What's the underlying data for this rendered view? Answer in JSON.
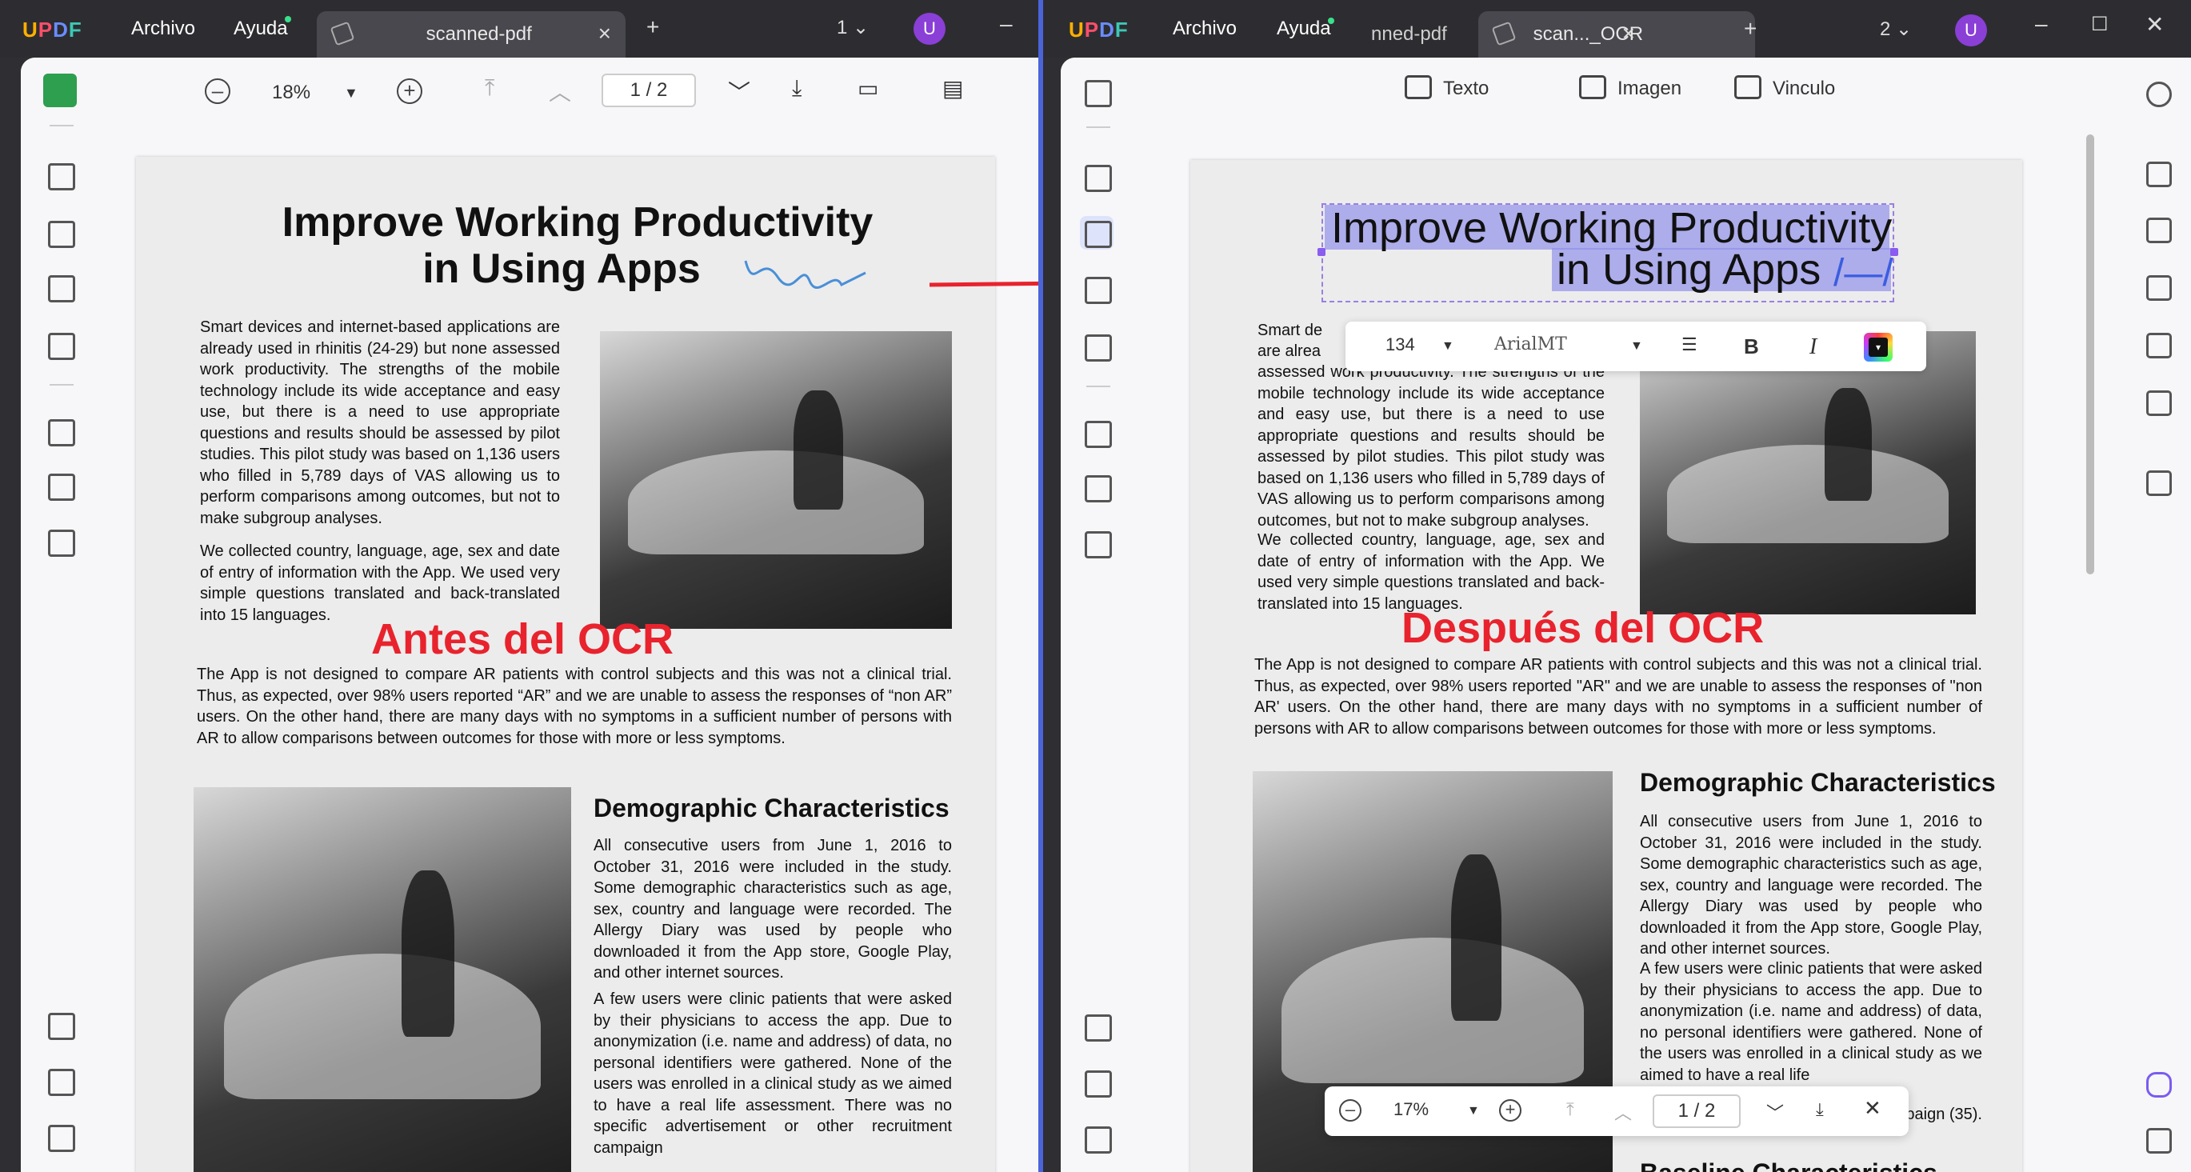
{
  "left": {
    "app_name": "UPDF",
    "menu": [
      "Archivo",
      "Ayuda"
    ],
    "tab_title": "scanned-pdf",
    "page_count_badge": "1",
    "avatar": "U",
    "zoom": "18%",
    "page_indicator": "1 / 2",
    "label": "Antes del OCR",
    "doc": {
      "title_line1": "Improve Working Productivity",
      "title_line2": "in Using Apps",
      "para1": "Smart devices and internet-based applications are already used in rhinitis (24-29) but none assessed work productivity. The strengths of the mobile technology include its wide acceptance and easy use, but there is a need to use appropriate questions and results should be assessed by pilot studies. This pilot study was based on 1,136 users who filled in 5,789 days of VAS allowing us to perform comparisons among outcomes, but not to make subgroup analyses.",
      "para2": "We collected country, language, age, sex and date of entry of information with the App. We used very simple questions translated and back-translated into 15 languages.",
      "para3": "The App is not designed to compare AR patients with control subjects and this was not a clinical trial. Thus, as expected, over 98% users reported “AR” and we are unable to assess the responses of “non AR” users. On the other hand, there are many days with no symptoms in a sufficient number of persons with AR to allow comparisons between outcomes for those with more or less symptoms.",
      "heading2": "Demographic Characteristics",
      "para4": "All consecutive users from June 1, 2016 to October 31, 2016 were included in the study. Some demographic characteristics such as age, sex, country and language were recorded. The Allergy Diary was used by people who downloaded it from the App store, Google Play, and other internet sources.",
      "para5": "A few users were clinic patients that were asked by their physicians to access the app. Due to anonymization (i.e. name and address) of data, no personal identifiers were gathered. None of the users was enrolled in a clinical study as we aimed to have a real life assessment. There was no specific advertisement or other recruitment campaign"
    }
  },
  "right": {
    "app_name": "UPDF",
    "menu": [
      "Archivo",
      "Ayuda"
    ],
    "tab1_title": "nned-pdf",
    "tab2_title": "scan..._OCR",
    "page_count_badge": "2",
    "avatar": "U",
    "edit_tools": [
      "Texto",
      "Imagen",
      "Vinculo"
    ],
    "font_size": "134",
    "font_name": "ArialMT",
    "bold": "B",
    "italic": "I",
    "label": "Después del OCR",
    "zoom": "17%",
    "page_indicator": "1 / 2",
    "doc": {
      "title_line1": "Improve Working Productivity",
      "title_line2": "in Using Apps",
      "para1_start": "Smart de",
      "para1_start2": "are alrea",
      "para1": "assessed work productivity. The strengths of the mobile technology include its wide acceptance and easy use, but there is a need to use appropriate questions and results should be assessed by pilot studies. This pilot study was based on 1,136 users who filled in 5,789 days of VAS allowing us to perform comparisons among outcomes, but not to make subgroup analyses.",
      "para2": "We collected country, language, age, sex and date of entry of information with the App. We used very simple questions translated and back-translated into 15 languages.",
      "para3": "The App is not designed to compare AR patients with control subjects and this was not a clinical trial. Thus, as expected, over 98% users reported \"AR\" and we are unable to assess the responses of \"non AR' users. On the other hand, there are many days with no symptoms in a sufficient number of persons with AR to allow comparisons between outcomes for those with more or less symptoms.",
      "heading2": "Demographic Characteristics",
      "para4": "All consecutive users from June 1, 2016 to October 31, 2016 were included in the study. Some demographic characteristics such as age, sex, country and language were recorded. The Allergy Diary was used by people who downloaded it from the App store, Google Play, and other internet sources.",
      "para5": "A few users were clinic patients that were asked by their physicians to access the app. Due to anonymization (i.e. name and address) of data, no personal identifiers were gathered. None of the users was enrolled in a clinical study as we aimed to have a real life",
      "para5_tail": "campaign (35).",
      "heading3": "Baseline Characteristics"
    }
  },
  "colors": {
    "accent": "#4b64d8",
    "label_red": "#e8232d",
    "selection": "#8c8ceb",
    "active_green": "#2e9e4f"
  }
}
